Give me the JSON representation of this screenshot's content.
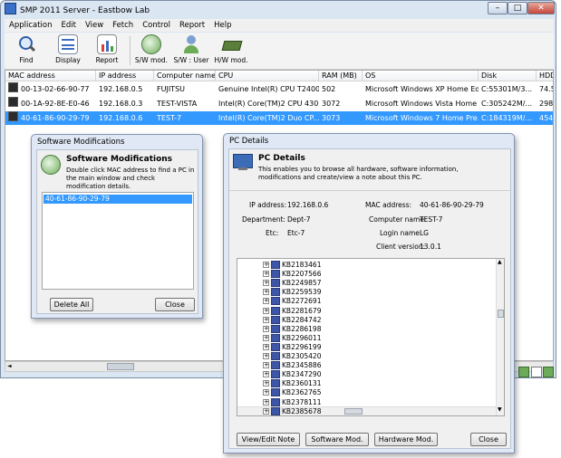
{
  "app": {
    "title": "SMP 2011 Server - Eastbow Lab"
  },
  "menu": [
    "Application",
    "Edit",
    "View",
    "Fetch",
    "Control",
    "Report",
    "Help"
  ],
  "toolbar": {
    "buttons": [
      {
        "label": "Find",
        "icon": "magnifier-icon"
      },
      {
        "label": "Display",
        "icon": "display-icon"
      },
      {
        "label": "Report",
        "icon": "report-icon"
      },
      {
        "label": "S/W mod.",
        "icon": "software-mod-icon"
      },
      {
        "label": "S/W : User",
        "icon": "software-user-icon"
      },
      {
        "label": "H/W mod.",
        "icon": "hardware-mod-icon"
      }
    ]
  },
  "grid": {
    "columns": [
      "MAC address",
      "IP address",
      "Computer name",
      "CPU",
      "RAM (MB)",
      "OS",
      "Disk",
      "HDD"
    ],
    "rows": [
      [
        "00-13-02-66-90-77",
        "192.168.0.5",
        "FUJITSU",
        "Genuine Intel(R) CPU T2400...",
        "502",
        "Microsoft Windows XP Home Ed...",
        "C:55301M/3...",
        "74.5"
      ],
      [
        "00-1A-92-8E-E0-46",
        "192.168.0.3",
        "TEST-VISTA",
        "Intel(R) Core(TM)2 CPU 430...",
        "3072",
        "Microsoft Windows Vista Home ...",
        "C:305242M/...",
        "298."
      ],
      [
        "40-61-86-90-29-79",
        "192.168.0.6",
        "TEST-7",
        "Intel(R) Core(TM)2 Duo CP...",
        "3073",
        "Microsoft Windows 7 Home Pre...",
        "C:184319M/...",
        "454."
      ]
    ],
    "selected_row": 2
  },
  "sw_dialog": {
    "title": "Software Modifications",
    "heading": "Software Modifications",
    "description": "Double click MAC address to find a PC in the main window and check modification details.",
    "list": [
      "40-61-86-90-29-79"
    ],
    "delete_all": "Delete All",
    "close": "Close"
  },
  "pc_dialog": {
    "title": "PC Details",
    "heading": "PC Details",
    "description": "This enables you to browse all hardware, software information, modifications and create/view a note about this PC.",
    "fields": {
      "ip_label": "IP address:",
      "ip_value": "192.168.0.6",
      "mac_label": "MAC address:",
      "mac_value": "40-61-86-90-29-79",
      "dept_label": "Department:",
      "dept_value": "Dept-7",
      "comp_label": "Computer name:",
      "comp_value": "TEST-7",
      "etc_label": "Etc:",
      "etc_value": "Etc-7",
      "login_label": "Login name:",
      "login_value": "LG",
      "client_label": "Client version:",
      "client_value": "13.0.1"
    },
    "tree": [
      "KB2183461",
      "KB2207566",
      "KB2249857",
      "KB2259539",
      "KB2272691",
      "KB2281679",
      "KB2284742",
      "KB2286198",
      "KB2296011",
      "KB2296199",
      "KB2305420",
      "KB2345886",
      "KB2347290",
      "KB2360131",
      "KB2362765",
      "KB2378111",
      "KB2385678"
    ],
    "buttons": {
      "note": "View/Edit Note",
      "sw": "Software Mod.",
      "hw": "Hardware Mod.",
      "close": "Close"
    }
  },
  "colors": {
    "selection": "#3399ff",
    "window_frame": "#dbe6f3"
  }
}
